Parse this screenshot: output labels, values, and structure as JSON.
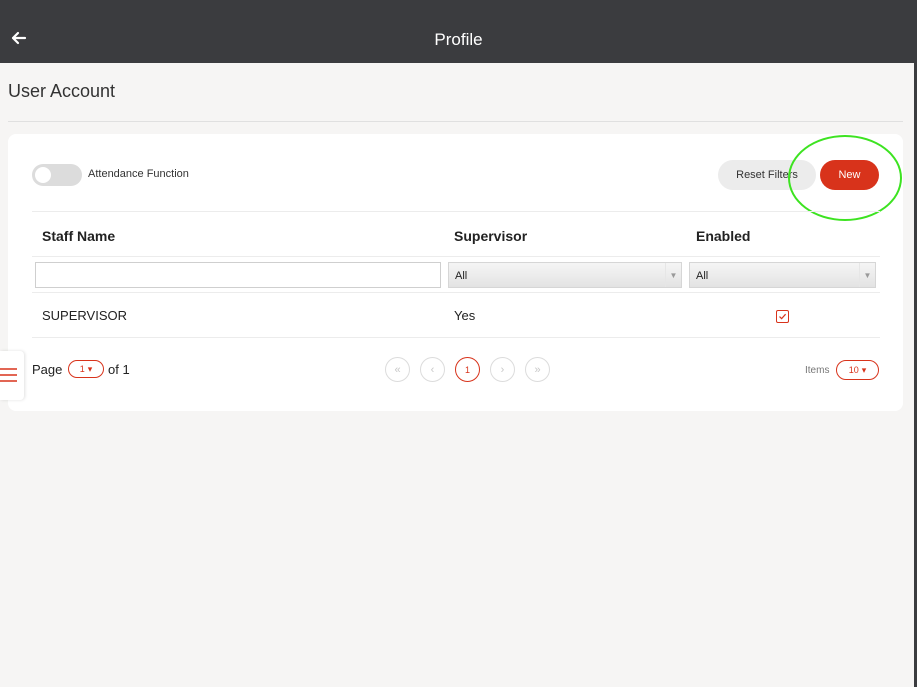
{
  "header": {
    "title": "Profile"
  },
  "page": {
    "heading": "User Account"
  },
  "toolbar": {
    "toggle_label": "Attendance Function",
    "toggle_on": false,
    "reset_filters_label": "Reset Filters",
    "new_label": "New"
  },
  "table": {
    "columns": [
      "Staff Name",
      "Supervisor",
      "Enabled"
    ],
    "filters": {
      "staff_name": {
        "value": "",
        "placeholder": ""
      },
      "supervisor": {
        "selected": "All"
      },
      "enabled": {
        "selected": "All"
      }
    },
    "rows": [
      {
        "staff_name": "SUPERVISOR",
        "supervisor": "Yes",
        "enabled": true
      }
    ]
  },
  "pagination": {
    "page_label": "Page",
    "current_page": "1",
    "of_label": "of 1",
    "pages": [
      "1"
    ],
    "items_label": "Items",
    "items_per_page": "10"
  },
  "icons": {
    "back": "arrow-left-icon",
    "menu": "hamburger-menu-icon",
    "first": "double-chevron-left-icon",
    "prev": "chevron-left-icon",
    "next": "chevron-right-icon",
    "last": "double-chevron-right-icon",
    "check": "checkmark-icon"
  },
  "colors": {
    "accent": "#d8331b",
    "header_bg": "#3b3c3f",
    "annotation": "#3de321"
  }
}
